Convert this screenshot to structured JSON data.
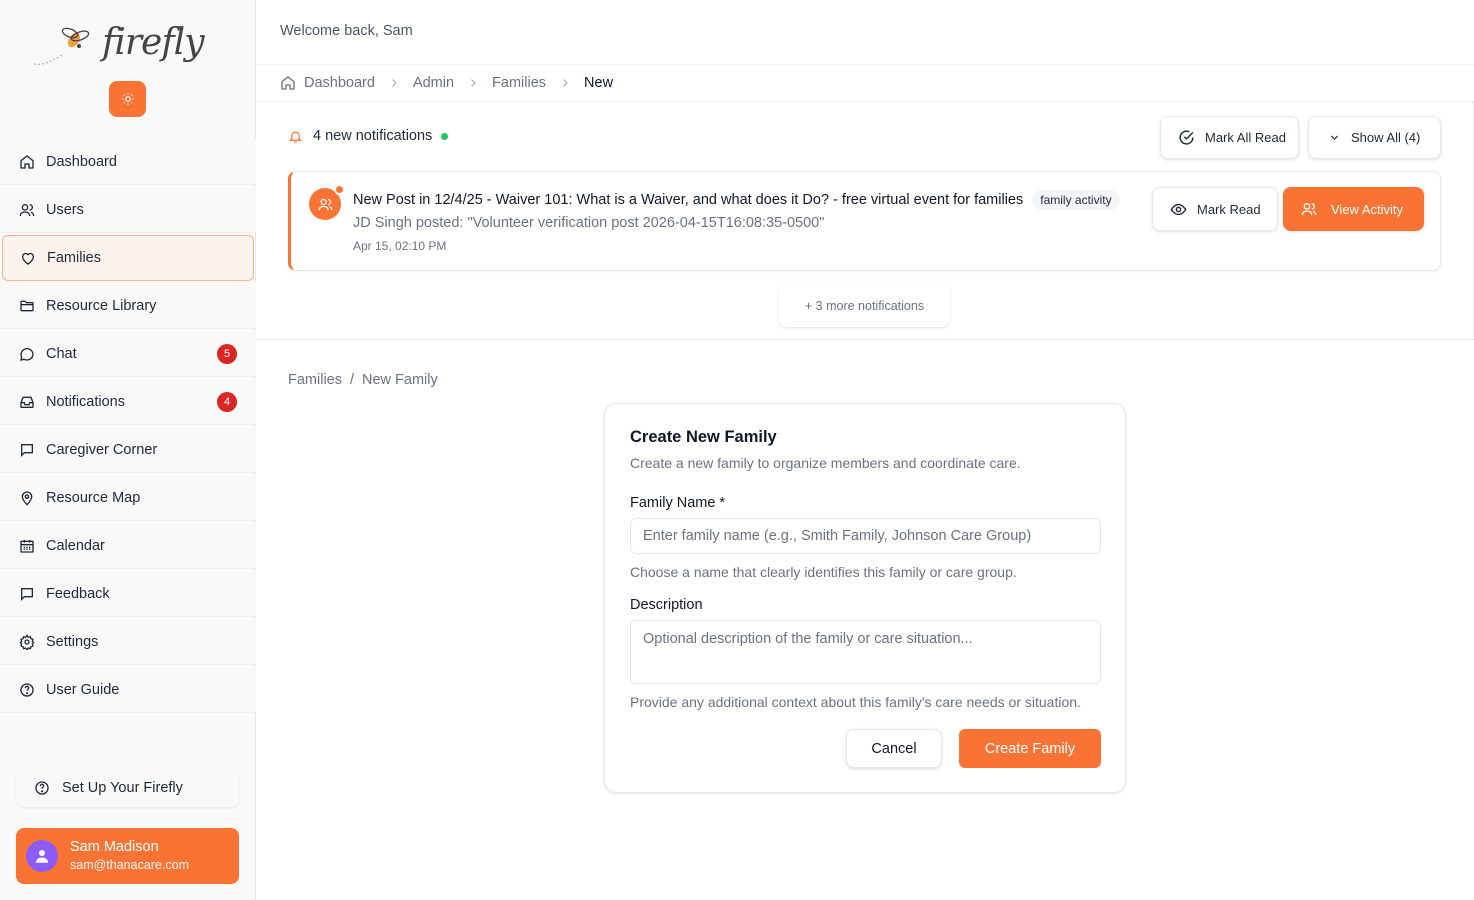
{
  "app": {
    "logo_text": "firefly",
    "accent": "#f97335"
  },
  "sidebar": {
    "items": [
      {
        "label": "Dashboard",
        "icon": "home-icon"
      },
      {
        "label": "Users",
        "icon": "users-icon"
      },
      {
        "label": "Families",
        "icon": "heart-icon",
        "active": true
      },
      {
        "label": "Resource Library",
        "icon": "folder-icon"
      },
      {
        "label": "Chat",
        "icon": "chat-icon",
        "badge": "5"
      },
      {
        "label": "Notifications",
        "icon": "inbox-icon",
        "badge": "4"
      },
      {
        "label": "Caregiver Corner",
        "icon": "message-square-icon"
      },
      {
        "label": "Resource Map",
        "icon": "map-pin-icon"
      },
      {
        "label": "Calendar",
        "icon": "calendar-icon"
      },
      {
        "label": "Feedback",
        "icon": "feedback-icon"
      },
      {
        "label": "Settings",
        "icon": "gear-icon"
      },
      {
        "label": "User Guide",
        "icon": "help-circle-icon"
      }
    ],
    "setup_label": "Set Up Your Firefly",
    "user": {
      "name": "Sam Madison",
      "email": "sam@thanacare.com"
    }
  },
  "header": {
    "welcome": "Welcome back, Sam",
    "breadcrumbs": [
      "Dashboard",
      "Admin",
      "Families",
      "New"
    ]
  },
  "notifications": {
    "heading": "4 new notifications",
    "mark_all_label": "Mark All Read",
    "show_all_label": "Show All (4)",
    "item": {
      "title": "New Post in 12/4/25 - Waiver 101: What is a Waiver, and what does it Do? - free virtual event for families",
      "tag": "family activity",
      "body": "JD Singh posted: \"Volunteer verification post 2026-04-15T16:08:35-0500\"",
      "time": "Apr 15, 02:10 PM",
      "mark_read_label": "Mark Read",
      "view_label": "View Activity"
    },
    "more_label": "+ 3 more notifications"
  },
  "page": {
    "crumbs": [
      "Families",
      "New Family"
    ],
    "form": {
      "title": "Create New Family",
      "subtitle": "Create a new family to organize members and coordinate care.",
      "name_label": "Family Name *",
      "name_placeholder": "Enter family name (e.g., Smith Family, Johnson Care Group)",
      "name_help": "Choose a name that clearly identifies this family or care group.",
      "desc_label": "Description",
      "desc_placeholder": "Optional description of the family or care situation...",
      "desc_help": "Provide any additional context about this family's care needs or situation.",
      "cancel_label": "Cancel",
      "create_label": "Create Family"
    }
  }
}
